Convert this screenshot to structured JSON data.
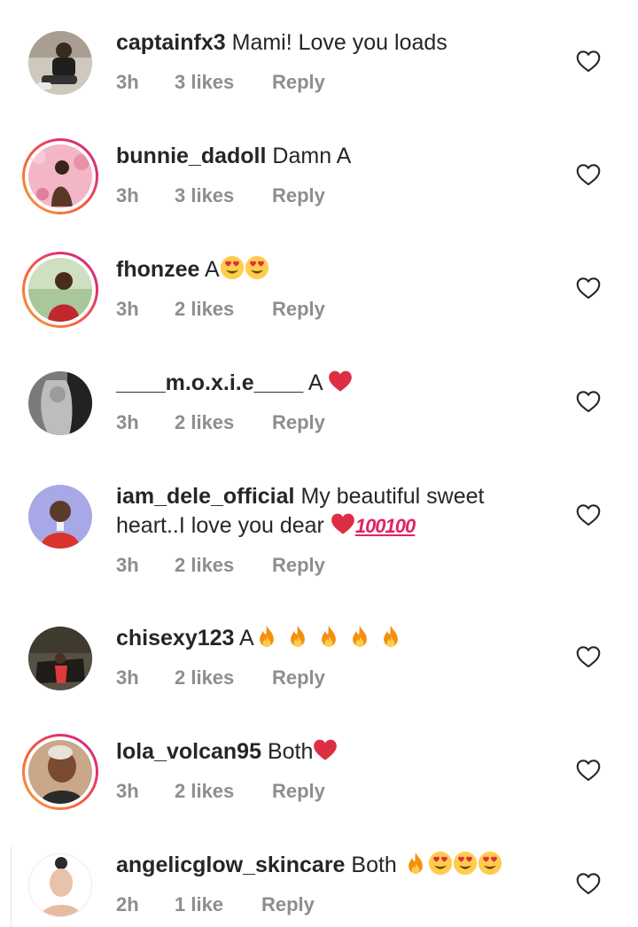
{
  "comments": [
    {
      "username": "captainfx3",
      "text": "Mami! Love you loads",
      "time": "3h",
      "likes": "3 likes",
      "reply": "Reply",
      "story": false
    },
    {
      "username": "bunnie_dadoll",
      "text": "Damn A",
      "time": "3h",
      "likes": "3 likes",
      "reply": "Reply",
      "story": true
    },
    {
      "username": "fhonzee",
      "text": "A",
      "time": "3h",
      "likes": "2 likes",
      "reply": "Reply",
      "story": true
    },
    {
      "username": "____m.o.x.i.e____",
      "text": "A",
      "time": "3h",
      "likes": "2 likes",
      "reply": "Reply",
      "story": false
    },
    {
      "username": "iam_dele_official",
      "text": "My beautiful sweet heart..I love you dear",
      "time": "3h",
      "likes": "2 likes",
      "reply": "Reply",
      "story": false
    },
    {
      "username": "chisexy123",
      "text": "A",
      "time": "3h",
      "likes": "2 likes",
      "reply": "Reply",
      "story": false
    },
    {
      "username": "lola_volcan95",
      "text": "Both",
      "time": "3h",
      "likes": "2 likes",
      "reply": "Reply",
      "story": true
    },
    {
      "username": "angelicglow_skincare",
      "text": "Both",
      "time": "2h",
      "likes": "1 like",
      "reply": "Reply",
      "story": false
    }
  ],
  "icons": {
    "like": "heart-outline-icon",
    "emoji_heart_eyes": "heart-eyes-emoji",
    "emoji_heart": "red-heart-emoji",
    "emoji_fire": "fire-emoji",
    "emoji_hundred": "hundred-points-emoji"
  },
  "colors": {
    "meta": "#8e8e8e",
    "story_ring_start": "#f9a13a",
    "story_ring_end": "#c13584",
    "heart_red": "#e0245e"
  }
}
